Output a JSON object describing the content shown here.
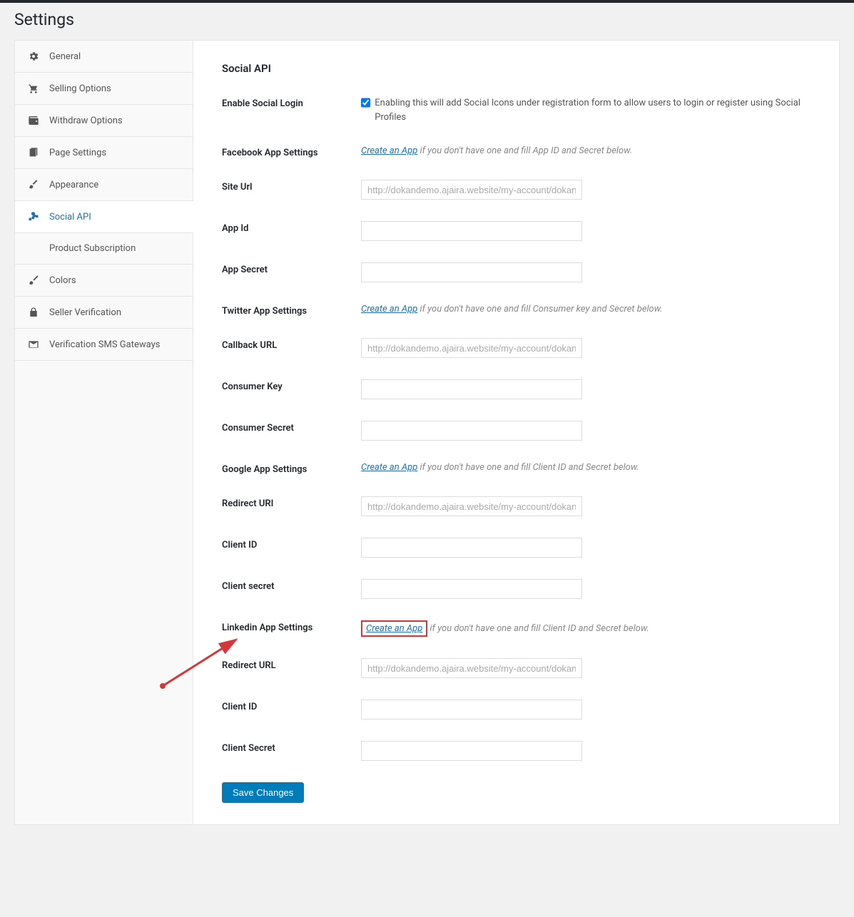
{
  "page": {
    "title": "Settings"
  },
  "sidebar": {
    "items": [
      {
        "label": "General"
      },
      {
        "label": "Selling Options"
      },
      {
        "label": "Withdraw Options"
      },
      {
        "label": "Page Settings"
      },
      {
        "label": "Appearance"
      },
      {
        "label": "Social API"
      },
      {
        "label": "Product Subscription"
      },
      {
        "label": "Colors"
      },
      {
        "label": "Seller Verification"
      },
      {
        "label": "Verification SMS Gateways"
      }
    ]
  },
  "content": {
    "heading": "Social API",
    "enable_label": "Enable Social Login",
    "enable_desc": "Enabling this will add Social Icons under registration form to allow users to login or register using Social Profiles",
    "create_app": "Create an App",
    "fb": {
      "label": "Facebook App Settings",
      "hint": " if you don't have one and fill App ID and Secret below."
    },
    "site_url": {
      "label": "Site Url",
      "placeholder": "http://dokandemo.ajaira.website/my-account/dokan-reg"
    },
    "app_id": {
      "label": "App Id"
    },
    "app_secret": {
      "label": "App Secret"
    },
    "tw": {
      "label": "Twitter App Settings",
      "hint": " if you don't have one and fill Consumer key and Secret below."
    },
    "callback_url": {
      "label": "Callback URL",
      "placeholder": "http://dokandemo.ajaira.website/my-account/dokan-reg"
    },
    "consumer_key": {
      "label": "Consumer Key"
    },
    "consumer_secret": {
      "label": "Consumer Secret"
    },
    "google": {
      "label": "Google App Settings",
      "hint": " if you don't have one and fill Client ID and Secret below."
    },
    "redirect_uri": {
      "label": "Redirect URI",
      "placeholder": "http://dokandemo.ajaira.website/my-account/dokan-reg"
    },
    "client_id_g": {
      "label": "Client ID"
    },
    "client_secret_g": {
      "label": "Client secret"
    },
    "linkedin": {
      "label": "Linkedin App Settings",
      "hint": " if you don't have one and fill Client ID and Secret below."
    },
    "redirect_url_l": {
      "label": "Redirect URL",
      "placeholder": "http://dokandemo.ajaira.website/my-account/dokan-reg"
    },
    "client_id_l": {
      "label": "Client ID"
    },
    "client_secret_l": {
      "label": "Client Secret"
    },
    "save": "Save Changes"
  }
}
